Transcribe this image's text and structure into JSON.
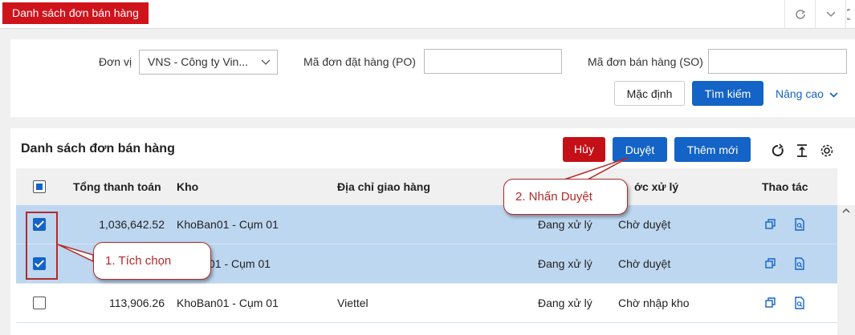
{
  "topbar": {
    "active_tab": "Danh sách đơn bán hàng",
    "icons": [
      "refresh-icon",
      "chevron-down-icon",
      "expand-icon"
    ]
  },
  "filters": {
    "unit_label": "Đơn vị",
    "unit_value": "VNS - Công ty Vin...",
    "po_label": "Mã đơn đặt hàng (PO)",
    "po_value": "",
    "so_label": "Mã đơn bán hàng (SO)",
    "so_value": "",
    "default_button": "Mặc định",
    "search_button": "Tìm kiếm",
    "advanced_link": "Nâng cao"
  },
  "list": {
    "title": "Danh sách đơn bán hàng",
    "cancel_button": "Hủy",
    "approve_button": "Duyệt",
    "add_button": "Thêm mới",
    "columns": [
      "Tổng thanh toán",
      "Kho",
      "Địa chỉ giao hàng",
      "ớc xử lý",
      "Thao tác"
    ],
    "rows": [
      {
        "checked": true,
        "total": "1,036,642.52",
        "warehouse": "KhoBan01 - Cụm 01",
        "address": "",
        "status": "Đang xử lý",
        "step": "Chờ duyệt"
      },
      {
        "checked": true,
        "total": "",
        "warehouse": "01 - Cụm 01",
        "address": "",
        "status": "Đang xử lý",
        "step": "Chờ duyệt"
      },
      {
        "checked": false,
        "total": "113,906.26",
        "warehouse": "KhoBan01 - Cụm 01",
        "address": "Viettel",
        "status": "Đang xử lý",
        "step": "Chờ nhập kho"
      }
    ]
  },
  "annotations": {
    "callout_1": "1. Tích chọn",
    "callout_2": "2. Nhấn Duyệt"
  },
  "colors": {
    "red": "#c40f17",
    "blue": "#1463c6",
    "selected_row": "#bdd7f1",
    "annotation": "#b12a2a"
  }
}
